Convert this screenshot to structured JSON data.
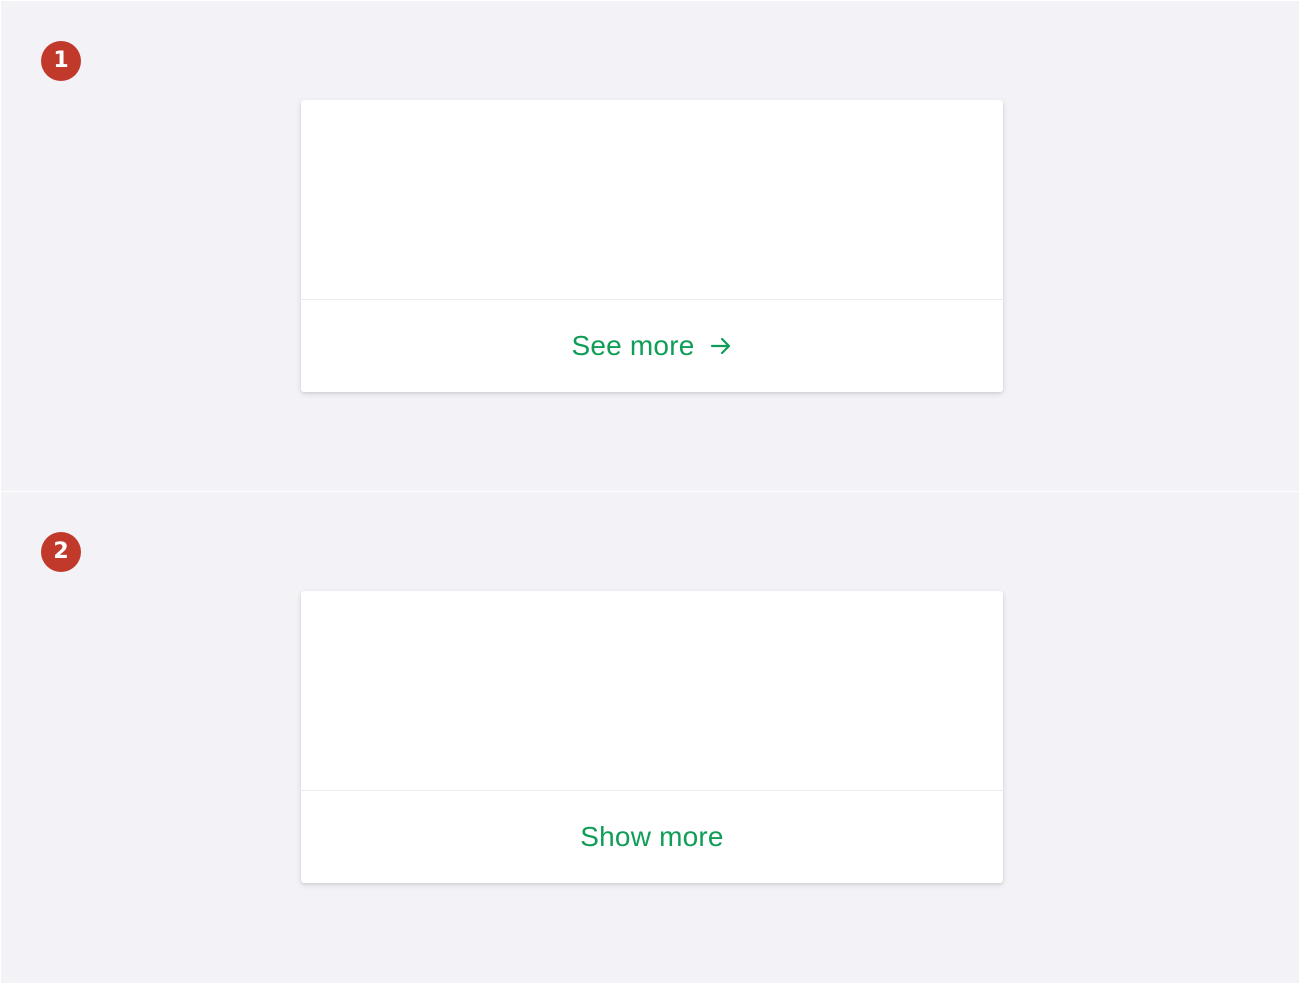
{
  "colors": {
    "background": "#f2f2f7",
    "badge": "#c0392b",
    "link": "#0f9d58",
    "card": "#ffffff"
  },
  "panels": [
    {
      "badge": "1",
      "link_label": "See more",
      "icon": "arrow-right-icon"
    },
    {
      "badge": "2",
      "link_label": "Show more"
    }
  ]
}
